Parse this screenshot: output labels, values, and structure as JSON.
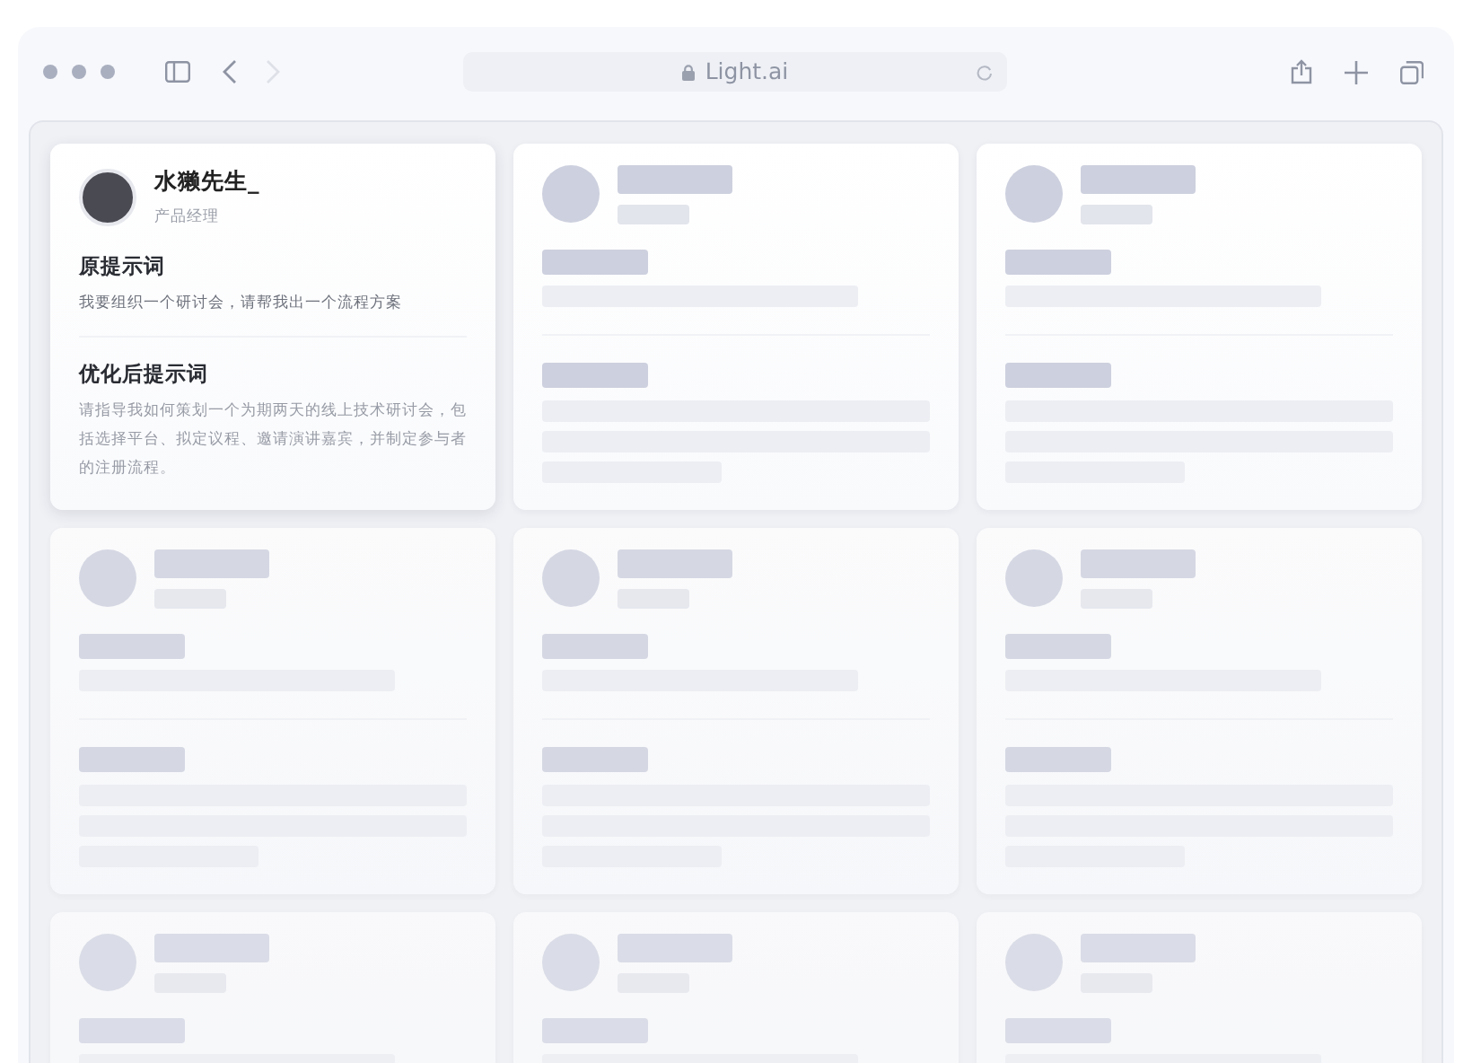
{
  "browser": {
    "url": "Light.ai",
    "back_disabled": false,
    "forward_disabled": true
  },
  "cards": [
    {
      "kind": "filled",
      "author": "水獭先生_",
      "role": "产品经理",
      "sections": [
        {
          "heading": "原提示词",
          "text": "我要组织一个研讨会，请帮我出一个流程方案"
        },
        {
          "heading": "优化后提示词",
          "text": "请指导我如何策划一个为期两天的线上技术研讨会，包括选择平台、拟定议程、邀请演讲嘉宾，并制定参与者的注册流程。"
        }
      ]
    },
    {
      "kind": "skeleton"
    },
    {
      "kind": "skeleton"
    },
    {
      "kind": "skeleton"
    },
    {
      "kind": "skeleton"
    },
    {
      "kind": "skeleton"
    },
    {
      "kind": "skeleton"
    },
    {
      "kind": "skeleton"
    },
    {
      "kind": "skeleton"
    }
  ]
}
